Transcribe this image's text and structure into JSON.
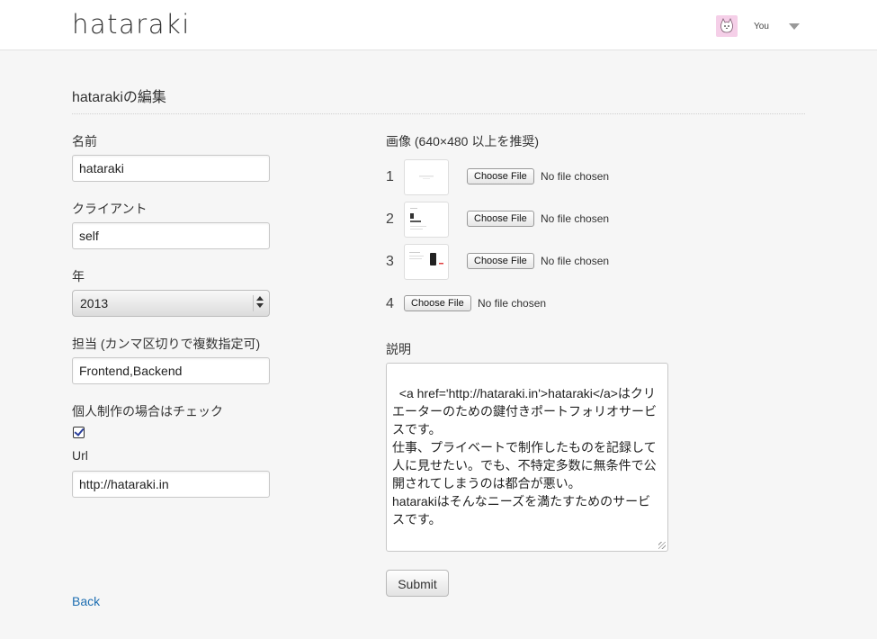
{
  "header": {
    "logo": "hataraki",
    "user_name": "You"
  },
  "page": {
    "title": "hatarakiの編集"
  },
  "form": {
    "name": {
      "label": "名前",
      "value": "hataraki"
    },
    "client": {
      "label": "クライアント",
      "value": "self"
    },
    "year": {
      "label": "年",
      "selected": "2013"
    },
    "roles": {
      "label": "担当 (カンマ区切りで複数指定可)",
      "value": "Frontend,Backend"
    },
    "personal": {
      "label": "個人制作の場合はチェック",
      "checked": true
    },
    "url": {
      "label": "Url",
      "value": "http://hataraki.in"
    },
    "back_label": "Back",
    "images": {
      "label": "画像 (640×480 以上を推奨)",
      "items": [
        {
          "num": "1",
          "button": "Choose File",
          "status": "No file chosen"
        },
        {
          "num": "2",
          "button": "Choose File",
          "status": "No file chosen"
        },
        {
          "num": "3",
          "button": "Choose File",
          "status": "No file chosen"
        },
        {
          "num": "4",
          "button": "Choose File",
          "status": "No file chosen"
        }
      ]
    },
    "description": {
      "label": "説明",
      "value": "<a href='http://hataraki.in'>hataraki</a>はクリエーターのための鍵付きポートフォリオサービスです。\n仕事、プライベートで制作したものを記録して人に見せたい。でも、不特定多数に無条件で公開されてしまうのは都合が悪い。\nhatarakiはそんなニーズを満たすためのサービスです。"
    },
    "submit_label": "Submit"
  },
  "colors": {
    "link": "#1f6fb2",
    "avatar_bg": "#f5cfe8"
  }
}
